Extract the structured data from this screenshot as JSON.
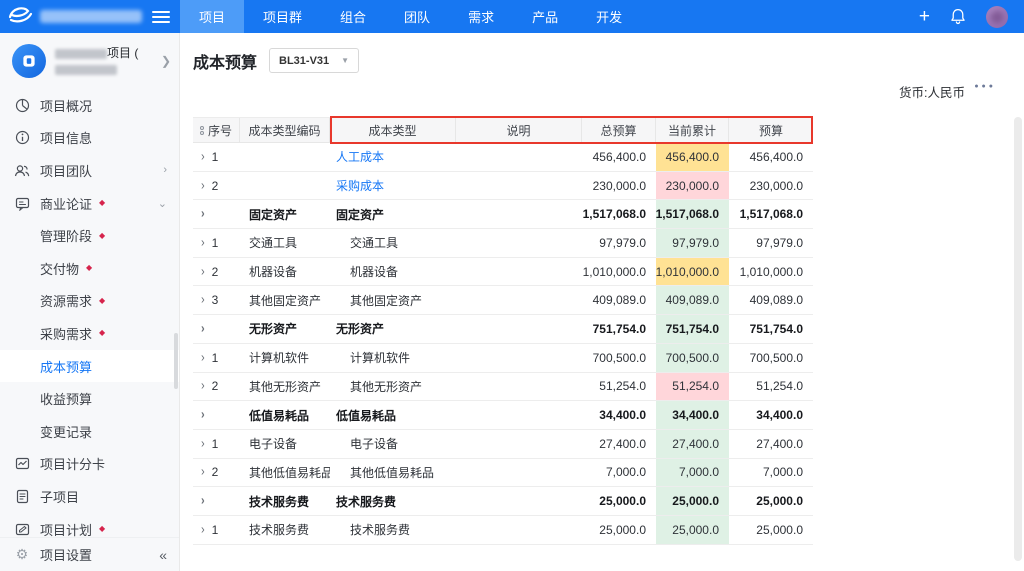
{
  "colors": {
    "topbar_blue": "#1777f2",
    "active_tab_blue": "#4d9cf8",
    "link_blue": "#1677f5",
    "annotation_red": "#e8382c",
    "diamond_red": "#d6244c",
    "highlight": {
      "yellow": "#ffe294",
      "pink": "#ffd6da",
      "green": "#dff1e5"
    }
  },
  "topbar": {
    "tabs": [
      {
        "label": "项目",
        "active": true
      },
      {
        "label": "项目群",
        "active": false
      },
      {
        "label": "组合",
        "active": false
      },
      {
        "label": "团队",
        "active": false
      },
      {
        "label": "需求",
        "active": false
      },
      {
        "label": "产品",
        "active": false
      },
      {
        "label": "开发",
        "active": false
      }
    ],
    "plus": "+"
  },
  "sidebar": {
    "project": {
      "title_suffix": "项目 ("
    },
    "items": [
      {
        "label": "项目概况",
        "icon": "pie-chart-icon",
        "level": 0
      },
      {
        "label": "项目信息",
        "icon": "info-icon",
        "level": 0
      },
      {
        "label": "项目团队",
        "icon": "team-icon",
        "level": 0,
        "chevron": "right"
      },
      {
        "label": "商业论证",
        "icon": "business-case-icon",
        "level": 0,
        "diamond": true,
        "chevron": "down"
      },
      {
        "label": "管理阶段",
        "level": 1,
        "diamond": true
      },
      {
        "label": "交付物",
        "level": 1,
        "diamond": true
      },
      {
        "label": "资源需求",
        "level": 1,
        "diamond": true
      },
      {
        "label": "采购需求",
        "level": 1,
        "diamond": true
      },
      {
        "label": "成本预算",
        "level": 1,
        "selected": true
      },
      {
        "label": "收益预算",
        "level": 1
      },
      {
        "label": "变更记录",
        "level": 1
      },
      {
        "label": "项目计分卡",
        "icon": "scorecard-icon",
        "level": 0
      },
      {
        "label": "子项目",
        "icon": "subproject-icon",
        "level": 0
      },
      {
        "label": "项目计划",
        "icon": "plan-icon",
        "level": 0,
        "diamond": true
      }
    ],
    "settings": {
      "label": "项目设置",
      "icon": "gear-icon",
      "collapse": "«"
    }
  },
  "main": {
    "title": "成本预算",
    "version": "BL31-V31",
    "currency_label": "货币:人民币",
    "table": {
      "headers": [
        "序号",
        "成本类型编码",
        "成本类型",
        "说明",
        "总预算",
        "当前累计",
        "预算"
      ],
      "rows": [
        {
          "num": "1",
          "code": "",
          "name": "人工成本",
          "style": "link",
          "desc": "",
          "total": "456,400.0",
          "current": "456,400.0",
          "budget": "456,400.0",
          "current_bg": "yellow"
        },
        {
          "num": "2",
          "code": "",
          "name": "采购成本",
          "style": "link",
          "desc": "",
          "total": "230,000.0",
          "current": "230,000.0",
          "budget": "230,000.0",
          "current_bg": "pink"
        },
        {
          "num": "",
          "code": "固定资产",
          "name": "固定资产",
          "style": "bold",
          "desc": "",
          "total": "1,517,068.0",
          "current": "1,517,068.0",
          "budget": "1,517,068.0",
          "current_bg": "green"
        },
        {
          "num": "1",
          "code": "交通工具",
          "name": "交通工具",
          "style": "child",
          "desc": "",
          "total": "97,979.0",
          "current": "97,979.0",
          "budget": "97,979.0",
          "current_bg": "green"
        },
        {
          "num": "2",
          "code": "机器设备",
          "name": "机器设备",
          "style": "child",
          "desc": "",
          "total": "1,010,000.0",
          "current": "1,010,000.0",
          "budget": "1,010,000.0",
          "current_bg": "yellow"
        },
        {
          "num": "3",
          "code": "其他固定资产",
          "name": "其他固定资产",
          "style": "child",
          "desc": "",
          "total": "409,089.0",
          "current": "409,089.0",
          "budget": "409,089.0",
          "current_bg": "green"
        },
        {
          "num": "",
          "code": "无形资产",
          "name": "无形资产",
          "style": "bold",
          "desc": "",
          "total": "751,754.0",
          "current": "751,754.0",
          "budget": "751,754.0",
          "current_bg": "green"
        },
        {
          "num": "1",
          "code": "计算机软件",
          "name": "计算机软件",
          "style": "child",
          "desc": "",
          "total": "700,500.0",
          "current": "700,500.0",
          "budget": "700,500.0",
          "current_bg": "green"
        },
        {
          "num": "2",
          "code": "其他无形资产",
          "name": "其他无形资产",
          "style": "child",
          "desc": "",
          "total": "51,254.0",
          "current": "51,254.0",
          "budget": "51,254.0",
          "current_bg": "pink"
        },
        {
          "num": "",
          "code": "低值易耗品",
          "name": "低值易耗品",
          "style": "bold",
          "desc": "",
          "total": "34,400.0",
          "current": "34,400.0",
          "budget": "34,400.0",
          "current_bg": "green"
        },
        {
          "num": "1",
          "code": "电子设备",
          "name": "电子设备",
          "style": "child",
          "desc": "",
          "total": "27,400.0",
          "current": "27,400.0",
          "budget": "27,400.0",
          "current_bg": "green"
        },
        {
          "num": "2",
          "code": "其他低值易耗品",
          "name": "其他低值易耗品",
          "style": "child",
          "desc": "",
          "total": "7,000.0",
          "current": "7,000.0",
          "budget": "7,000.0",
          "current_bg": "green"
        },
        {
          "num": "",
          "code": "技术服务费",
          "name": "技术服务费",
          "style": "bold",
          "desc": "",
          "total": "25,000.0",
          "current": "25,000.0",
          "budget": "25,000.0",
          "current_bg": "green"
        },
        {
          "num": "1",
          "code": "技术服务费",
          "name": "技术服务费",
          "style": "child",
          "desc": "",
          "total": "25,000.0",
          "current": "25,000.0",
          "budget": "25,000.0",
          "current_bg": "green"
        }
      ]
    }
  }
}
